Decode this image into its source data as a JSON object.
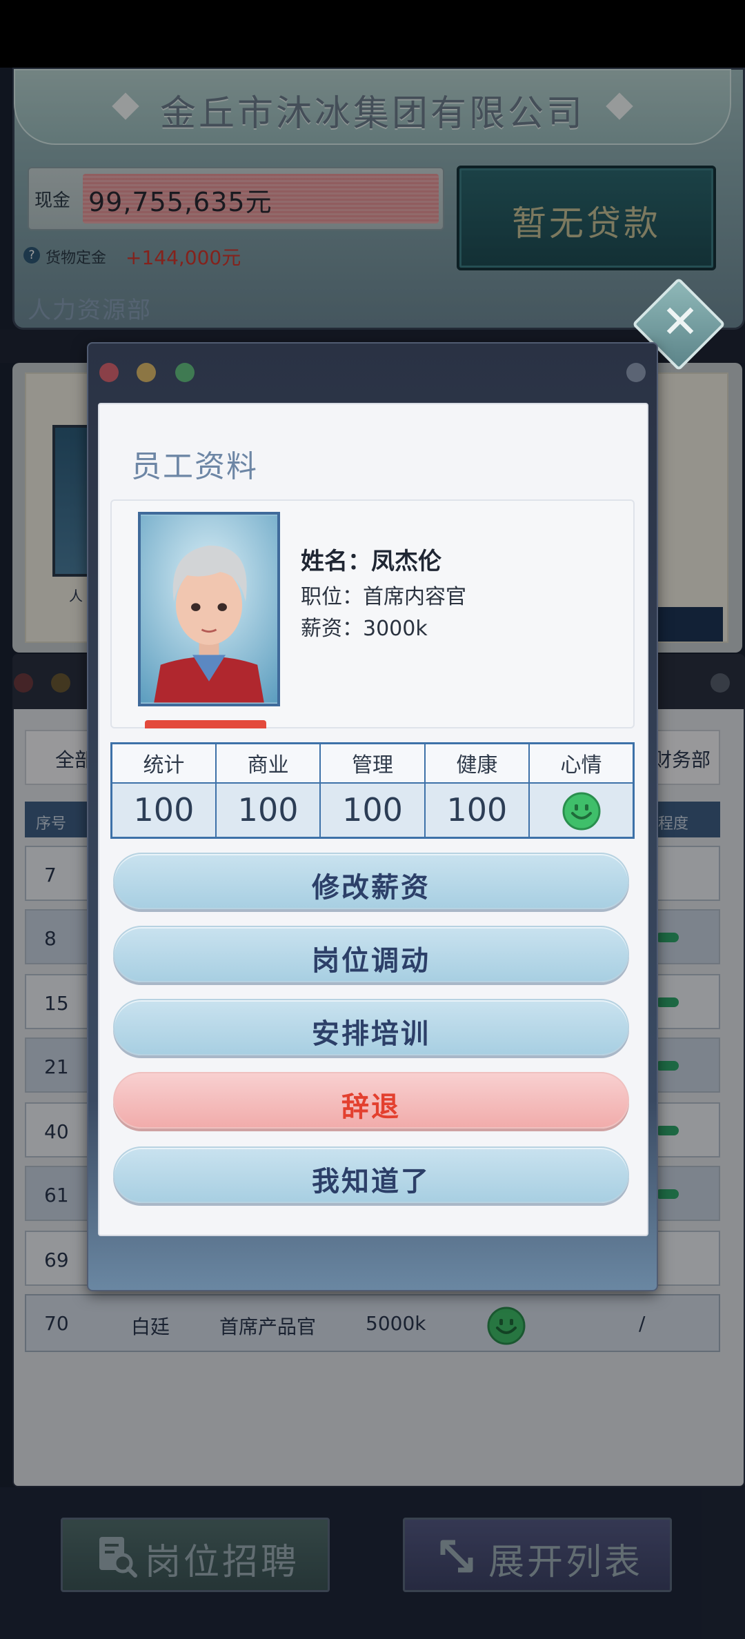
{
  "company": {
    "name": "金丘市沐冰集团有限公司",
    "cash_label": "现金",
    "cash_value": "99,755,635元",
    "deposit_label": "货物定金",
    "deposit_value": "+144,000元",
    "loan_label": "暂无贷款",
    "department": "人力资源部"
  },
  "background_list": {
    "tab_all": "全部",
    "tab_finance": "财务部",
    "header_no": "序号",
    "header_degree": "程度",
    "rows": [
      "7",
      "8",
      "15",
      "21",
      "40",
      "61",
      "69"
    ],
    "last_row": {
      "no": "70",
      "name": "白廷",
      "position": "首席产品官",
      "salary": "5000k",
      "value": "/"
    },
    "bg_card_label": "人"
  },
  "bottom": {
    "recruit_label": "岗位招聘",
    "expand_label": "展开列表"
  },
  "dialog": {
    "title": "员工资料",
    "name_line": "姓名：凤杰伦",
    "position_line": "职位：首席内容官",
    "salary_line": "薪资：3000k",
    "stats": {
      "headers": [
        "统计",
        "商业",
        "管理",
        "健康",
        "心情"
      ],
      "values": [
        "100",
        "100",
        "100",
        "100"
      ]
    },
    "actions": {
      "change_salary": "修改薪资",
      "transfer": "岗位调动",
      "training": "安排培训",
      "dismiss": "辞退",
      "ok": "我知道了"
    }
  },
  "colors": {
    "accent_blue": "#3d71a8",
    "danger_red": "#e3402f",
    "mood_green": "#3fbf6a"
  }
}
